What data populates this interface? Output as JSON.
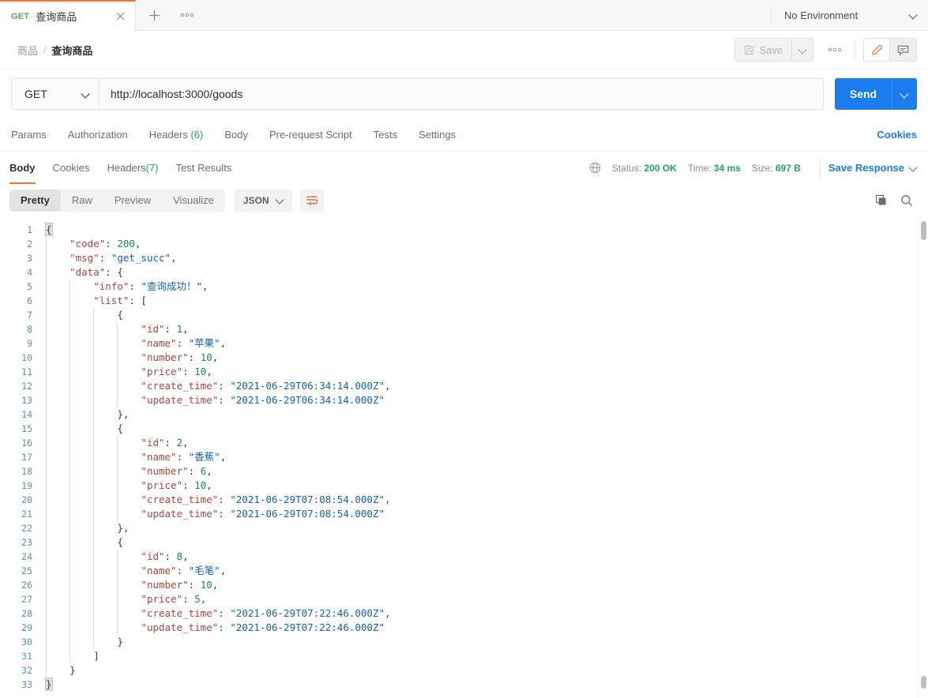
{
  "tabbar": {
    "tab": {
      "method": "GET",
      "title": "查询商品",
      "close_icon": "close-icon"
    },
    "new_tab_label": "+",
    "more_label": "●●●",
    "environment": {
      "label": "No Environment"
    }
  },
  "header": {
    "breadcrumb_parent": "商品",
    "breadcrumb_sep": "/",
    "breadcrumb_current": "查询商品",
    "save_label": "Save",
    "more_label": "●●●"
  },
  "request": {
    "method": "GET",
    "url": "http://localhost:3000/goods",
    "send_label": "Send",
    "tabs": [
      {
        "label": "Params",
        "count": ""
      },
      {
        "label": "Authorization",
        "count": ""
      },
      {
        "label": "Headers",
        "count": "(6)"
      },
      {
        "label": "Body",
        "count": ""
      },
      {
        "label": "Pre-request Script",
        "count": ""
      },
      {
        "label": "Tests",
        "count": ""
      },
      {
        "label": "Settings",
        "count": ""
      }
    ],
    "cookies_link": "Cookies"
  },
  "response": {
    "tabs": [
      {
        "label": "Body",
        "count": ""
      },
      {
        "label": "Cookies",
        "count": ""
      },
      {
        "label": "Headers",
        "count": "(7)"
      },
      {
        "label": "Test Results",
        "count": ""
      }
    ],
    "active_tab": "Body",
    "status_label": "Status:",
    "status_value": "200 OK",
    "time_label": "Time:",
    "time_value": "34 ms",
    "size_label": "Size:",
    "size_value": "697 B",
    "save_response_label": "Save Response",
    "views": [
      "Pretty",
      "Raw",
      "Preview",
      "Visualize"
    ],
    "active_view": "Pretty",
    "format": "JSON",
    "wrap_icon": "word-wrap-icon",
    "copy_icon": "copy-icon",
    "search_icon": "search-icon"
  },
  "body_lines": [
    {
      "n": 1,
      "indent": 0,
      "tokens": [
        {
          "t": "{",
          "c": "p brk"
        }
      ]
    },
    {
      "n": 2,
      "indent": 1,
      "tokens": [
        {
          "t": "\"code\"",
          "c": "k"
        },
        {
          "t": ": ",
          "c": "p"
        },
        {
          "t": "200",
          "c": "n"
        },
        {
          "t": ",",
          "c": "p"
        }
      ]
    },
    {
      "n": 3,
      "indent": 1,
      "tokens": [
        {
          "t": "\"msg\"",
          "c": "k"
        },
        {
          "t": ": ",
          "c": "p"
        },
        {
          "t": "\"get_succ\"",
          "c": "s"
        },
        {
          "t": ",",
          "c": "p"
        }
      ]
    },
    {
      "n": 4,
      "indent": 1,
      "tokens": [
        {
          "t": "\"data\"",
          "c": "k"
        },
        {
          "t": ": {",
          "c": "p"
        }
      ]
    },
    {
      "n": 5,
      "indent": 2,
      "tokens": [
        {
          "t": "\"info\"",
          "c": "k"
        },
        {
          "t": ": ",
          "c": "p"
        },
        {
          "t": "\"查询成功！\"",
          "c": "s"
        },
        {
          "t": ",",
          "c": "p"
        }
      ]
    },
    {
      "n": 6,
      "indent": 2,
      "tokens": [
        {
          "t": "\"list\"",
          "c": "k"
        },
        {
          "t": ": [",
          "c": "p"
        }
      ]
    },
    {
      "n": 7,
      "indent": 3,
      "tokens": [
        {
          "t": "{",
          "c": "p"
        }
      ]
    },
    {
      "n": 8,
      "indent": 4,
      "tokens": [
        {
          "t": "\"id\"",
          "c": "k"
        },
        {
          "t": ": ",
          "c": "p"
        },
        {
          "t": "1",
          "c": "n"
        },
        {
          "t": ",",
          "c": "p"
        }
      ]
    },
    {
      "n": 9,
      "indent": 4,
      "tokens": [
        {
          "t": "\"name\"",
          "c": "k"
        },
        {
          "t": ": ",
          "c": "p"
        },
        {
          "t": "\"苹果\"",
          "c": "s"
        },
        {
          "t": ",",
          "c": "p"
        }
      ]
    },
    {
      "n": 10,
      "indent": 4,
      "tokens": [
        {
          "t": "\"number\"",
          "c": "k"
        },
        {
          "t": ": ",
          "c": "p"
        },
        {
          "t": "10",
          "c": "n"
        },
        {
          "t": ",",
          "c": "p"
        }
      ]
    },
    {
      "n": 11,
      "indent": 4,
      "tokens": [
        {
          "t": "\"price\"",
          "c": "k"
        },
        {
          "t": ": ",
          "c": "p"
        },
        {
          "t": "10",
          "c": "n"
        },
        {
          "t": ",",
          "c": "p"
        }
      ]
    },
    {
      "n": 12,
      "indent": 4,
      "tokens": [
        {
          "t": "\"create_time\"",
          "c": "k"
        },
        {
          "t": ": ",
          "c": "p"
        },
        {
          "t": "\"2021-06-29T06:34:14.000Z\"",
          "c": "s"
        },
        {
          "t": ",",
          "c": "p"
        }
      ]
    },
    {
      "n": 13,
      "indent": 4,
      "tokens": [
        {
          "t": "\"update_time\"",
          "c": "k"
        },
        {
          "t": ": ",
          "c": "p"
        },
        {
          "t": "\"2021-06-29T06:34:14.000Z\"",
          "c": "s"
        }
      ]
    },
    {
      "n": 14,
      "indent": 3,
      "tokens": [
        {
          "t": "},",
          "c": "p"
        }
      ]
    },
    {
      "n": 15,
      "indent": 3,
      "tokens": [
        {
          "t": "{",
          "c": "p"
        }
      ]
    },
    {
      "n": 16,
      "indent": 4,
      "tokens": [
        {
          "t": "\"id\"",
          "c": "k"
        },
        {
          "t": ": ",
          "c": "p"
        },
        {
          "t": "2",
          "c": "n"
        },
        {
          "t": ",",
          "c": "p"
        }
      ]
    },
    {
      "n": 17,
      "indent": 4,
      "tokens": [
        {
          "t": "\"name\"",
          "c": "k"
        },
        {
          "t": ": ",
          "c": "p"
        },
        {
          "t": "\"香蕉\"",
          "c": "s"
        },
        {
          "t": ",",
          "c": "p"
        }
      ]
    },
    {
      "n": 18,
      "indent": 4,
      "tokens": [
        {
          "t": "\"number\"",
          "c": "k"
        },
        {
          "t": ": ",
          "c": "p"
        },
        {
          "t": "6",
          "c": "n"
        },
        {
          "t": ",",
          "c": "p"
        }
      ]
    },
    {
      "n": 19,
      "indent": 4,
      "tokens": [
        {
          "t": "\"price\"",
          "c": "k"
        },
        {
          "t": ": ",
          "c": "p"
        },
        {
          "t": "10",
          "c": "n"
        },
        {
          "t": ",",
          "c": "p"
        }
      ]
    },
    {
      "n": 20,
      "indent": 4,
      "tokens": [
        {
          "t": "\"create_time\"",
          "c": "k"
        },
        {
          "t": ": ",
          "c": "p"
        },
        {
          "t": "\"2021-06-29T07:08:54.000Z\"",
          "c": "s"
        },
        {
          "t": ",",
          "c": "p"
        }
      ]
    },
    {
      "n": 21,
      "indent": 4,
      "tokens": [
        {
          "t": "\"update_time\"",
          "c": "k"
        },
        {
          "t": ": ",
          "c": "p"
        },
        {
          "t": "\"2021-06-29T07:08:54.000Z\"",
          "c": "s"
        }
      ]
    },
    {
      "n": 22,
      "indent": 3,
      "tokens": [
        {
          "t": "},",
          "c": "p"
        }
      ]
    },
    {
      "n": 23,
      "indent": 3,
      "tokens": [
        {
          "t": "{",
          "c": "p"
        }
      ]
    },
    {
      "n": 24,
      "indent": 4,
      "tokens": [
        {
          "t": "\"id\"",
          "c": "k"
        },
        {
          "t": ": ",
          "c": "p"
        },
        {
          "t": "8",
          "c": "n"
        },
        {
          "t": ",",
          "c": "p"
        }
      ]
    },
    {
      "n": 25,
      "indent": 4,
      "tokens": [
        {
          "t": "\"name\"",
          "c": "k"
        },
        {
          "t": ": ",
          "c": "p"
        },
        {
          "t": "\"毛笔\"",
          "c": "s"
        },
        {
          "t": ",",
          "c": "p"
        }
      ]
    },
    {
      "n": 26,
      "indent": 4,
      "tokens": [
        {
          "t": "\"number\"",
          "c": "k"
        },
        {
          "t": ": ",
          "c": "p"
        },
        {
          "t": "10",
          "c": "n"
        },
        {
          "t": ",",
          "c": "p"
        }
      ]
    },
    {
      "n": 27,
      "indent": 4,
      "tokens": [
        {
          "t": "\"price\"",
          "c": "k"
        },
        {
          "t": ": ",
          "c": "p"
        },
        {
          "t": "5",
          "c": "n"
        },
        {
          "t": ",",
          "c": "p"
        }
      ]
    },
    {
      "n": 28,
      "indent": 4,
      "tokens": [
        {
          "t": "\"create_time\"",
          "c": "k"
        },
        {
          "t": ": ",
          "c": "p"
        },
        {
          "t": "\"2021-06-29T07:22:46.000Z\"",
          "c": "s"
        },
        {
          "t": ",",
          "c": "p"
        }
      ]
    },
    {
      "n": 29,
      "indent": 4,
      "tokens": [
        {
          "t": "\"update_time\"",
          "c": "k"
        },
        {
          "t": ": ",
          "c": "p"
        },
        {
          "t": "\"2021-06-29T07:22:46.000Z\"",
          "c": "s"
        }
      ]
    },
    {
      "n": 30,
      "indent": 3,
      "tokens": [
        {
          "t": "}",
          "c": "p"
        }
      ]
    },
    {
      "n": 31,
      "indent": 2,
      "tokens": [
        {
          "t": "]",
          "c": "p"
        }
      ]
    },
    {
      "n": 32,
      "indent": 1,
      "tokens": [
        {
          "t": "}",
          "c": "p"
        }
      ]
    },
    {
      "n": 33,
      "indent": 0,
      "tokens": [
        {
          "t": "}",
          "c": "p brk"
        }
      ]
    }
  ],
  "colors": {
    "accent": "#ff6c37",
    "send_blue": "#1a7ced",
    "status_green": "#1faa5a",
    "json_key": "#b3433c",
    "json_string": "#0f62b5",
    "json_number": "#178a5b"
  }
}
